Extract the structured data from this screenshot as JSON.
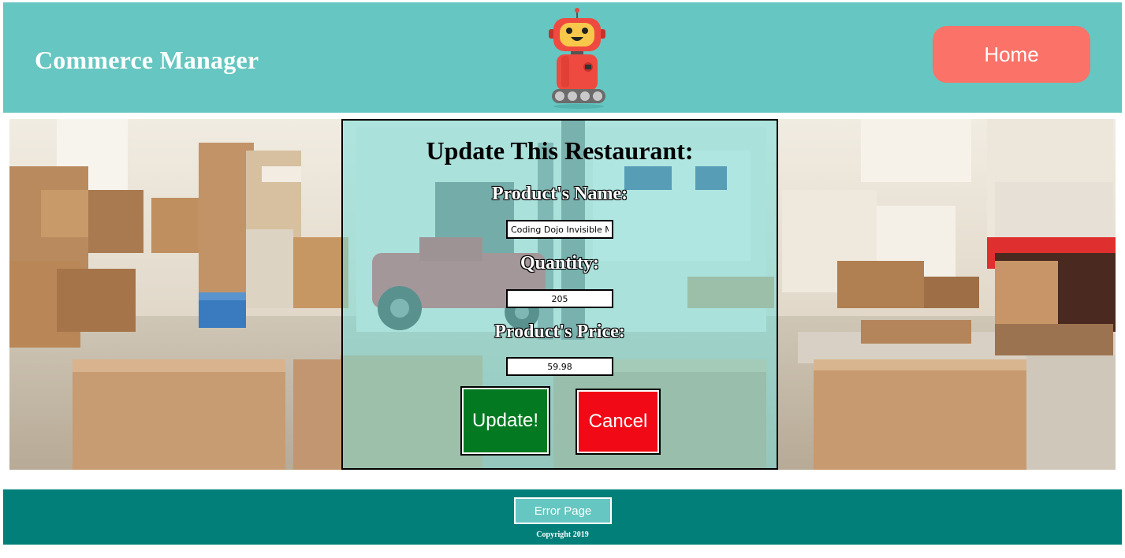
{
  "header": {
    "brand": "Commerce Manager",
    "home_label": "Home"
  },
  "form": {
    "title": "Update This Restaurant:",
    "name_label": "Product's Name:",
    "name_value": "Coding Dojo Invisible Mouse",
    "quantity_label": "Quantity:",
    "quantity_value": "205",
    "price_label": "Product's Price:",
    "price_value": "59.98",
    "update_label": "Update!",
    "cancel_label": "Cancel"
  },
  "footer": {
    "error_label": "Error Page",
    "copyright": "Copyright 2019"
  },
  "colors": {
    "header_bg": "#66c6c1",
    "home_button": "#fa7268",
    "footer_bg": "#027f79",
    "update_button": "#037a21",
    "cancel_button": "#f10a15"
  },
  "icons": {
    "logo": "robot-icon"
  }
}
